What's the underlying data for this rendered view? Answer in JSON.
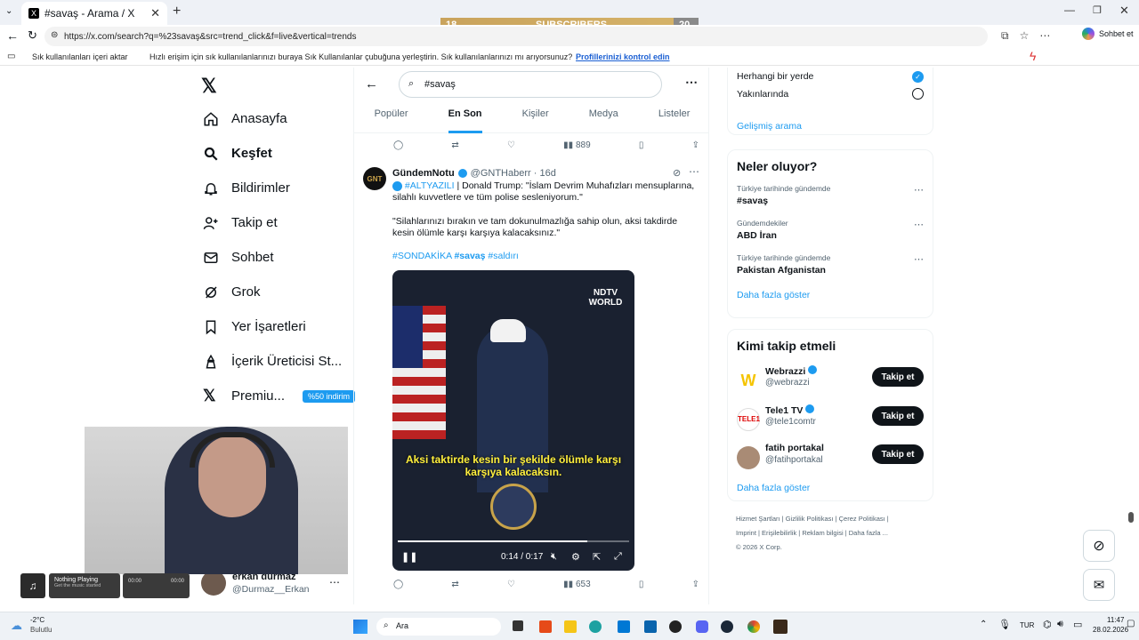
{
  "browser": {
    "tab_title": "#savaş - Arama / X",
    "url": "https://x.com/search?q=%23savaş&src=trend_click&f=live&vertical=trends",
    "chat_label": "Sohbet et",
    "bookmarks_import": "Sık kullanılanları içeri aktar",
    "bookmarks_hint": "Hızlı erişim için sık kullanılanlarınızı buraya Sık Kullanılanlar çubuğuna yerleştirin. Sık kullanılanlarınızı mı arıyorsunuz?",
    "bookmarks_link": "Profillerinizi kontrol edin"
  },
  "overlay": {
    "subs_left": "18",
    "subs_label": "SUBSCRIBERS",
    "subs_right": "20"
  },
  "nav": {
    "items": [
      {
        "label": "Anasayfa"
      },
      {
        "label": "Keşfet"
      },
      {
        "label": "Bildirimler"
      },
      {
        "label": "Takip et"
      },
      {
        "label": "Sohbet"
      },
      {
        "label": "Grok"
      },
      {
        "label": "Yer İşaretleri"
      },
      {
        "label": "İçerik Üreticisi St..."
      },
      {
        "label": "Premiu..."
      }
    ],
    "premium_badge": "%50 indirim"
  },
  "search": {
    "query": "#savaş"
  },
  "tabs": [
    "Popüler",
    "En Son",
    "Kişiler",
    "Medya",
    "Listeler"
  ],
  "prev_tweet": {
    "views": "889"
  },
  "tweet": {
    "name": "GündemNotu",
    "handle": "@GNTHaberr · 16d",
    "avatar_text": "GNT",
    "line1_tag": "#ALTYAZILI",
    "line1_text": "| Donald Trump:  \"İslam Devrim Muhafızları mensuplarına, silahlı kuvvetlere ve tüm polise sesleniyorum.\"",
    "line2_text": "\"Silahlarınızı bırakın ve tam dokunulmazlığa sahip olun, aksi takdirde kesin ölümle karşı karşıya kalacaksınız.\"",
    "tags": [
      "#SONDAKİKA",
      "#savaş",
      "#saldırı"
    ],
    "video_caption": "Aksi taktirde kesin bir şekilde ölümle karşı karşıya kalacaksın.",
    "video_brand": "NDTV WORLD",
    "video_time": "0:14 / 0:17",
    "video_progress": 0.82,
    "views": "653"
  },
  "right": {
    "location_anywhere": "Herhangi bir yerde",
    "location_near": "Yakınlarında",
    "advanced_search": "Gelişmiş arama",
    "whats_happening": "Neler oluyor?",
    "trends": [
      {
        "context": "Türkiye tarihinde gündemde",
        "title": "#savaş"
      },
      {
        "context": "Gündemdekiler",
        "title": "ABD İran"
      },
      {
        "context": "Türkiye tarihinde gündemde",
        "title": "Pakistan Afganistan"
      }
    ],
    "show_more": "Daha fazla göster",
    "who_to_follow": "Kimi takip etmeli",
    "follow_label": "Takip et",
    "accounts": [
      {
        "name": "Webrazzi",
        "handle": "@webrazzi"
      },
      {
        "name": "Tele1 TV",
        "handle": "@tele1comtr"
      },
      {
        "name": "fatih portakal",
        "handle": "@fatihportakal"
      }
    ],
    "show_more2": "Daha fazla göster",
    "footer": [
      "Hizmet Şartları",
      "Gizlilik Politikası",
      "Çerez Politikası",
      "Imprint",
      "Erişilebilirlik",
      "Reklam bilgisi",
      "Daha fazla ...",
      "© 2026 X Corp."
    ]
  },
  "user": {
    "name": "erkan durmaz",
    "handle": "@Durmaz__Erkan"
  },
  "music": {
    "title": "Nothing Playing",
    "subtitle": "Get the music started",
    "time_start": "00:00",
    "time_end": "00:00"
  },
  "taskbar": {
    "temp": "-2°C",
    "weather": "Bulutlu",
    "search": "Ara",
    "lang": "TUR",
    "time": "11:47",
    "date": "28.02.2026"
  }
}
